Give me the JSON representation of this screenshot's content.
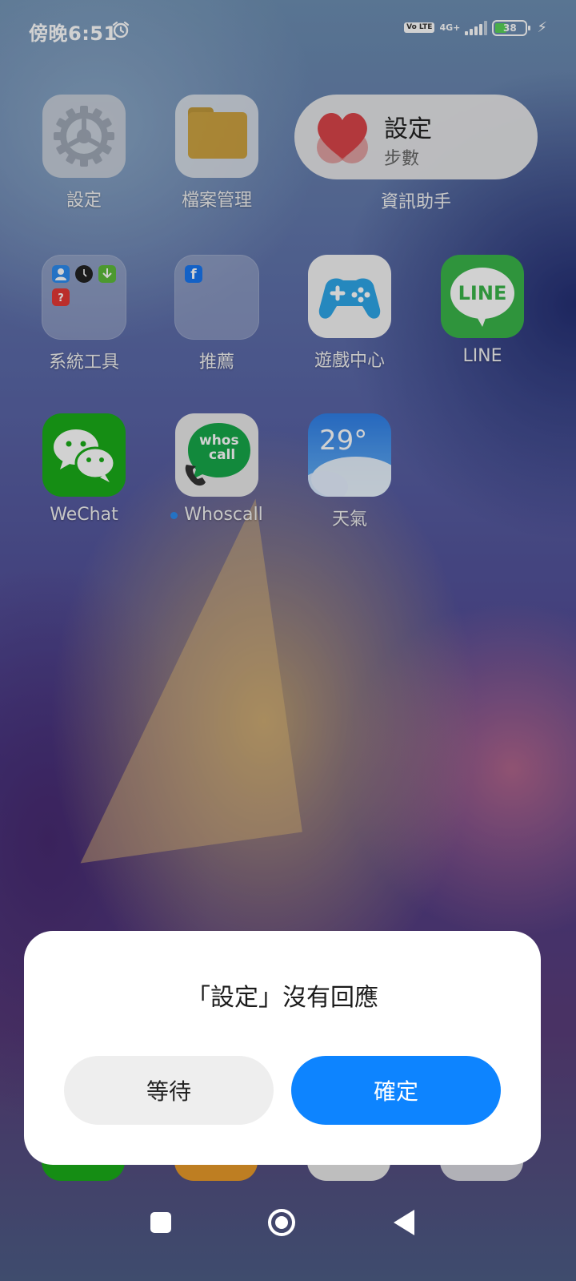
{
  "status_bar": {
    "time": "傍晚6:51",
    "volte": "Vo LTE",
    "network": "4G+",
    "battery": "38"
  },
  "apps": {
    "settings": "設定",
    "file_manager": "檔案管理",
    "system_tools": "系統工具",
    "recommended": "推薦",
    "game_center": "遊戲中心",
    "line": "LINE",
    "wechat": "WeChat",
    "whoscall": "Whoscall",
    "weather": "天氣"
  },
  "widget": {
    "title": "設定",
    "subtitle": "步數",
    "label": "資訊助手"
  },
  "icon_text": {
    "line_logo": "LINE",
    "whoscall_logo_1": "whos",
    "whoscall_logo_2": "call",
    "weather_temp": "29°",
    "facebook": "f"
  },
  "dialog": {
    "title": "「設定」沒有回應",
    "wait_label": "等待",
    "ok_label": "確定"
  },
  "colors": {
    "accent": "#0d84ff",
    "line_green": "#3ab54a",
    "wechat_green": "#1aad19"
  }
}
